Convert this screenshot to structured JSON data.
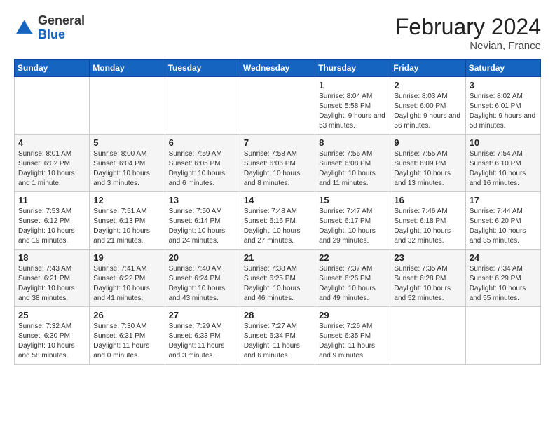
{
  "header": {
    "logo": {
      "text_general": "General",
      "text_blue": "Blue"
    },
    "title": "February 2024",
    "location": "Nevian, France"
  },
  "days_of_week": [
    "Sunday",
    "Monday",
    "Tuesday",
    "Wednesday",
    "Thursday",
    "Friday",
    "Saturday"
  ],
  "weeks": [
    {
      "cells": [
        {
          "empty": true
        },
        {
          "empty": true
        },
        {
          "empty": true
        },
        {
          "empty": true
        },
        {
          "day": 1,
          "sunrise": "8:04 AM",
          "sunset": "5:58 PM",
          "daylight": "9 hours and 53 minutes."
        },
        {
          "day": 2,
          "sunrise": "8:03 AM",
          "sunset": "6:00 PM",
          "daylight": "9 hours and 56 minutes."
        },
        {
          "day": 3,
          "sunrise": "8:02 AM",
          "sunset": "6:01 PM",
          "daylight": "9 hours and 58 minutes."
        }
      ]
    },
    {
      "cells": [
        {
          "day": 4,
          "sunrise": "8:01 AM",
          "sunset": "6:02 PM",
          "daylight": "10 hours and 1 minute."
        },
        {
          "day": 5,
          "sunrise": "8:00 AM",
          "sunset": "6:04 PM",
          "daylight": "10 hours and 3 minutes."
        },
        {
          "day": 6,
          "sunrise": "7:59 AM",
          "sunset": "6:05 PM",
          "daylight": "10 hours and 6 minutes."
        },
        {
          "day": 7,
          "sunrise": "7:58 AM",
          "sunset": "6:06 PM",
          "daylight": "10 hours and 8 minutes."
        },
        {
          "day": 8,
          "sunrise": "7:56 AM",
          "sunset": "6:08 PM",
          "daylight": "10 hours and 11 minutes."
        },
        {
          "day": 9,
          "sunrise": "7:55 AM",
          "sunset": "6:09 PM",
          "daylight": "10 hours and 13 minutes."
        },
        {
          "day": 10,
          "sunrise": "7:54 AM",
          "sunset": "6:10 PM",
          "daylight": "10 hours and 16 minutes."
        }
      ]
    },
    {
      "cells": [
        {
          "day": 11,
          "sunrise": "7:53 AM",
          "sunset": "6:12 PM",
          "daylight": "10 hours and 19 minutes."
        },
        {
          "day": 12,
          "sunrise": "7:51 AM",
          "sunset": "6:13 PM",
          "daylight": "10 hours and 21 minutes."
        },
        {
          "day": 13,
          "sunrise": "7:50 AM",
          "sunset": "6:14 PM",
          "daylight": "10 hours and 24 minutes."
        },
        {
          "day": 14,
          "sunrise": "7:48 AM",
          "sunset": "6:16 PM",
          "daylight": "10 hours and 27 minutes."
        },
        {
          "day": 15,
          "sunrise": "7:47 AM",
          "sunset": "6:17 PM",
          "daylight": "10 hours and 29 minutes."
        },
        {
          "day": 16,
          "sunrise": "7:46 AM",
          "sunset": "6:18 PM",
          "daylight": "10 hours and 32 minutes."
        },
        {
          "day": 17,
          "sunrise": "7:44 AM",
          "sunset": "6:20 PM",
          "daylight": "10 hours and 35 minutes."
        }
      ]
    },
    {
      "cells": [
        {
          "day": 18,
          "sunrise": "7:43 AM",
          "sunset": "6:21 PM",
          "daylight": "10 hours and 38 minutes."
        },
        {
          "day": 19,
          "sunrise": "7:41 AM",
          "sunset": "6:22 PM",
          "daylight": "10 hours and 41 minutes."
        },
        {
          "day": 20,
          "sunrise": "7:40 AM",
          "sunset": "6:24 PM",
          "daylight": "10 hours and 43 minutes."
        },
        {
          "day": 21,
          "sunrise": "7:38 AM",
          "sunset": "6:25 PM",
          "daylight": "10 hours and 46 minutes."
        },
        {
          "day": 22,
          "sunrise": "7:37 AM",
          "sunset": "6:26 PM",
          "daylight": "10 hours and 49 minutes."
        },
        {
          "day": 23,
          "sunrise": "7:35 AM",
          "sunset": "6:28 PM",
          "daylight": "10 hours and 52 minutes."
        },
        {
          "day": 24,
          "sunrise": "7:34 AM",
          "sunset": "6:29 PM",
          "daylight": "10 hours and 55 minutes."
        }
      ]
    },
    {
      "cells": [
        {
          "day": 25,
          "sunrise": "7:32 AM",
          "sunset": "6:30 PM",
          "daylight": "10 hours and 58 minutes."
        },
        {
          "day": 26,
          "sunrise": "7:30 AM",
          "sunset": "6:31 PM",
          "daylight": "11 hours and 0 minutes."
        },
        {
          "day": 27,
          "sunrise": "7:29 AM",
          "sunset": "6:33 PM",
          "daylight": "11 hours and 3 minutes."
        },
        {
          "day": 28,
          "sunrise": "7:27 AM",
          "sunset": "6:34 PM",
          "daylight": "11 hours and 6 minutes."
        },
        {
          "day": 29,
          "sunrise": "7:26 AM",
          "sunset": "6:35 PM",
          "daylight": "11 hours and 9 minutes."
        },
        {
          "empty": true
        },
        {
          "empty": true
        }
      ]
    }
  ]
}
